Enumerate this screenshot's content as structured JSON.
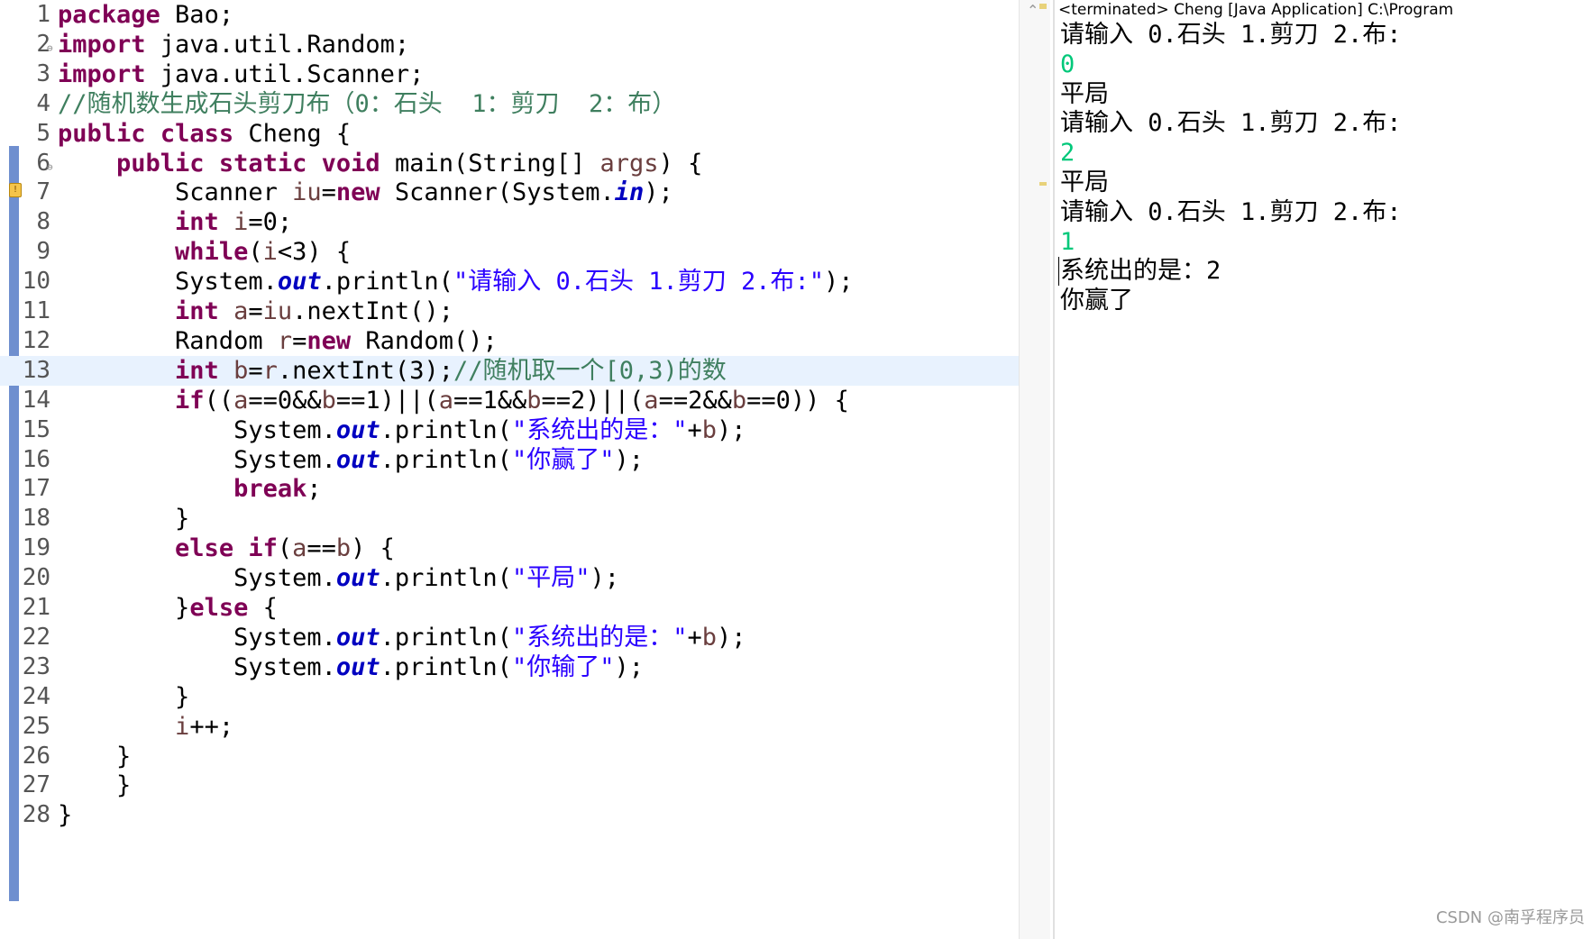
{
  "editor": {
    "lines": [
      {
        "n": "1",
        "html": "<span class='kw'>package</span> Bao;"
      },
      {
        "n": "2",
        "html": "<span class='kw'>import</span> java.util.Random;",
        "fold": true
      },
      {
        "n": "3",
        "html": "<span class='kw'>import</span> java.util.Scanner;"
      },
      {
        "n": "4",
        "html": "<span class='cm'>//随机数生成石头剪刀布（0：石头  1：剪刀  2：布）</span>"
      },
      {
        "n": "5",
        "html": "<span class='kw'>public</span> <span class='kw'>class</span> Cheng {"
      },
      {
        "n": "6",
        "html": "    <span class='kw'>public</span> <span class='kw'>static</span> <span class='kw'>void</span> main(String[] <span class='var'>args</span>) {",
        "fold": true
      },
      {
        "n": "7",
        "html": "        Scanner <span class='var'>iu</span>=<span class='kw'>new</span> Scanner(System.<span class='fi'>in</span>);"
      },
      {
        "n": "8",
        "html": "        <span class='kw'>int</span> <span class='var'>i</span>=0;"
      },
      {
        "n": "9",
        "html": "        <span class='kw'>while</span>(<span class='var'>i</span>&lt;3) {"
      },
      {
        "n": "10",
        "html": "        System.<span class='fi'>out</span>.println(<span class='st'>\"请输入 0.石头 1.剪刀 2.布:\"</span>);"
      },
      {
        "n": "11",
        "html": "        <span class='kw'>int</span> <span class='var'>a</span>=<span class='var'>iu</span>.nextInt();"
      },
      {
        "n": "12",
        "html": "        Random <span class='var'>r</span>=<span class='kw'>new</span> Random();"
      },
      {
        "n": "13",
        "html": "        <span class='kw'>int</span> <span class='var'>b</span>=<span class='var'>r</span>.nextInt(3);<span class='cm'>//随机取一个[0,3)的数</span>",
        "current": true
      },
      {
        "n": "14",
        "html": "        <span class='kw'>if</span>((<span class='var'>a</span>==0&amp;&amp;<span class='var'>b</span>==1)||(<span class='var'>a</span>==1&amp;&amp;<span class='var'>b</span>==2)||(<span class='var'>a</span>==2&amp;&amp;<span class='var'>b</span>==0)) {"
      },
      {
        "n": "15",
        "html": "            System.<span class='fi'>out</span>.println(<span class='st'>\"系统出的是：\"</span>+<span class='var'>b</span>);"
      },
      {
        "n": "16",
        "html": "            System.<span class='fi'>out</span>.println(<span class='st'>\"你赢了\"</span>);"
      },
      {
        "n": "17",
        "html": "            <span class='kw'>break</span>;"
      },
      {
        "n": "18",
        "html": "        }"
      },
      {
        "n": "19",
        "html": "        <span class='kw'>else</span> <span class='kw'>if</span>(<span class='var'>a</span>==<span class='var'>b</span>) {"
      },
      {
        "n": "20",
        "html": "            System.<span class='fi'>out</span>.println(<span class='st'>\"平局\"</span>);"
      },
      {
        "n": "21",
        "html": "        }<span class='kw'>else</span> {"
      },
      {
        "n": "22",
        "html": "            System.<span class='fi'>out</span>.println(<span class='st'>\"系统出的是：\"</span>+<span class='var'>b</span>);"
      },
      {
        "n": "23",
        "html": "            System.<span class='fi'>out</span>.println(<span class='st'>\"你输了\"</span>);"
      },
      {
        "n": "24",
        "html": "        }"
      },
      {
        "n": "25",
        "html": "        <span class='var'>i</span>++;"
      },
      {
        "n": "26",
        "html": "    }"
      },
      {
        "n": "27",
        "html": "    }"
      },
      {
        "n": "28",
        "html": "}"
      }
    ]
  },
  "console": {
    "title": "<terminated> Cheng [Java Application] C:\\Program",
    "output": [
      {
        "text": "请输入 0.石头 1.剪刀 2.布:",
        "input": false
      },
      {
        "text": "0",
        "input": true
      },
      {
        "text": "平局",
        "input": false
      },
      {
        "text": "请输入 0.石头 1.剪刀 2.布:",
        "input": false
      },
      {
        "text": "2",
        "input": true
      },
      {
        "text": "平局",
        "input": false
      },
      {
        "text": "请输入 0.石头 1.剪刀 2.布:",
        "input": false
      },
      {
        "text": "1",
        "input": true
      },
      {
        "text": "系统出的是：2",
        "input": false
      },
      {
        "text": "你赢了",
        "input": false
      }
    ]
  },
  "watermark": "CSDN @南孚程序员",
  "colors": {
    "keyword": "#7f0055",
    "string": "#2a00ff",
    "comment": "#3f7f5f",
    "field": "#0000c0",
    "current_line": "#e8f2fe",
    "console_input": "#00c87a"
  }
}
